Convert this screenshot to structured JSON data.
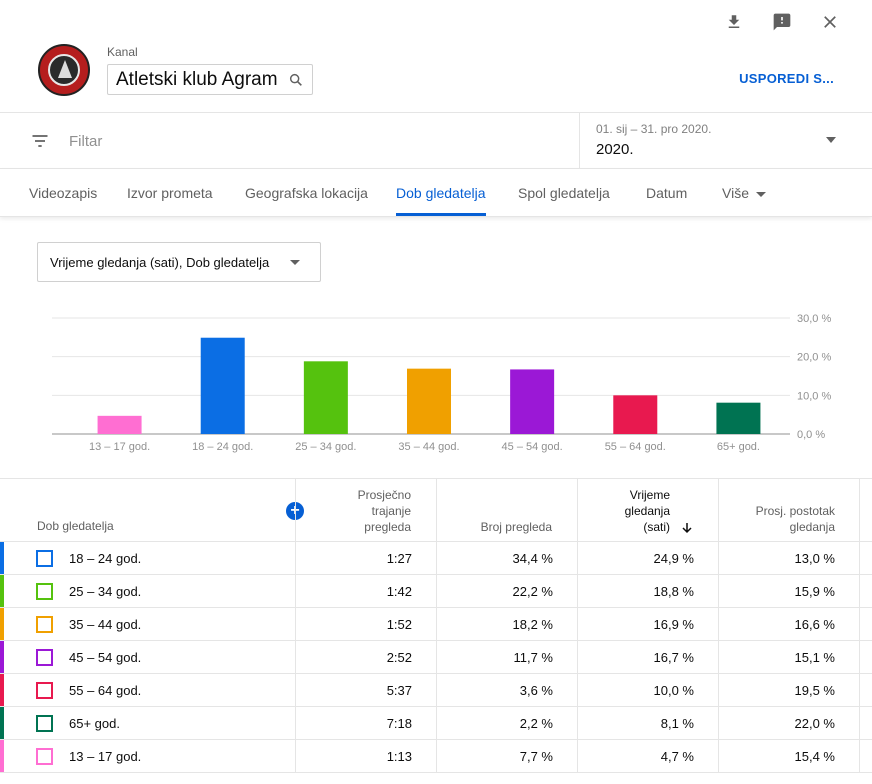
{
  "actions": {
    "download": "download-icon",
    "feedback": "feedback-icon",
    "close": "close-icon"
  },
  "channel": {
    "label": "Kanal",
    "name": "Atletski klub Agram",
    "compare": "USPOREDI S..."
  },
  "filter": {
    "placeholder": "Filtar",
    "date_range": "01. sij – 31. pro 2020.",
    "date_label": "2020."
  },
  "tabs": [
    {
      "label": "Videozapis"
    },
    {
      "label": "Izvor prometa"
    },
    {
      "label": "Geografska lokacija"
    },
    {
      "label": "Dob gledatelja"
    },
    {
      "label": "Spol gledatelja"
    },
    {
      "label": "Datum"
    },
    {
      "label": "Više"
    }
  ],
  "metric_select": "Vrijeme gledanja (sati), Dob gledatelja",
  "chart_data": {
    "type": "bar",
    "categories": [
      "13 – 17 god.",
      "18 – 24 god.",
      "25 – 34 god.",
      "35 – 44 god.",
      "45 – 54 god.",
      "55 – 64 god.",
      "65+ god."
    ],
    "values": [
      4.7,
      24.9,
      18.8,
      16.9,
      16.7,
      10.0,
      8.1
    ],
    "colors": [
      "#ff6ed2",
      "#0b6ee4",
      "#55c20e",
      "#f0a000",
      "#9b18d6",
      "#e8194f",
      "#007352"
    ],
    "ylim": [
      0,
      30
    ],
    "yticks": [
      "0,0 %",
      "10,0 %",
      "20,0 %",
      "30,0 %"
    ],
    "grid": true
  },
  "table": {
    "headers": {
      "dimension": "Dob gledatelja",
      "avg_duration": [
        "Prosječno",
        "trajanje",
        "pregleda"
      ],
      "views": "Broj pregleda",
      "watch_time": [
        "Vrijeme",
        "gledanja",
        "(sati)"
      ],
      "avg_pct": [
        "Prosj. postotak",
        "gledanja"
      ]
    },
    "rows": [
      {
        "age": "18 – 24 god.",
        "color": "#0b6ee4",
        "duration": "1:27",
        "views": "34,4 %",
        "watch": "24,9 %",
        "pct": "13,0 %"
      },
      {
        "age": "25 – 34 god.",
        "color": "#55c20e",
        "duration": "1:42",
        "views": "22,2 %",
        "watch": "18,8 %",
        "pct": "15,9 %"
      },
      {
        "age": "35 – 44 god.",
        "color": "#f0a000",
        "duration": "1:52",
        "views": "18,2 %",
        "watch": "16,9 %",
        "pct": "16,6 %"
      },
      {
        "age": "45 – 54 god.",
        "color": "#9b18d6",
        "duration": "2:52",
        "views": "11,7 %",
        "watch": "16,7 %",
        "pct": "15,1 %"
      },
      {
        "age": "55 – 64 god.",
        "color": "#e8194f",
        "duration": "5:37",
        "views": "3,6 %",
        "watch": "10,0 %",
        "pct": "19,5 %"
      },
      {
        "age": "65+ god.",
        "color": "#007352",
        "duration": "7:18",
        "views": "2,2 %",
        "watch": "8,1 %",
        "pct": "22,0 %"
      },
      {
        "age": "13 – 17 god.",
        "color": "#ff6ed2",
        "duration": "1:13",
        "views": "7,7 %",
        "watch": "4,7 %",
        "pct": "15,4 %"
      }
    ]
  }
}
